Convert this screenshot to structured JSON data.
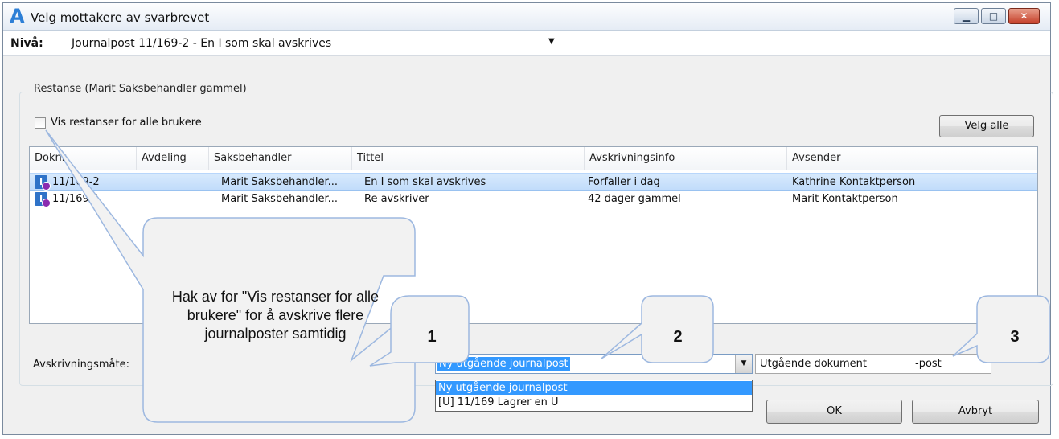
{
  "window": {
    "app_icon": "A",
    "title": "Velg mottakere av svarbrevet",
    "buttons": {
      "minimize": "▁",
      "maximize": "□",
      "close": "✕"
    }
  },
  "level": {
    "label": "Nivå:",
    "value": "Journalpost 11/169-2 - En I som skal avskrives",
    "arrow": "▼"
  },
  "restanse": {
    "group_title": "Restanse (Marit Saksbehandler gammel)",
    "checkbox_label": "Vis restanser for alle brukere",
    "checked": false,
    "select_all_label": "Velg alle"
  },
  "table": {
    "columns": [
      "Doknr",
      "Avdeling",
      "Saksbehandler",
      "Tittel",
      "Avskrivningsinfo",
      "Avsender"
    ],
    "rows": [
      {
        "icon": "I",
        "doknr": "11/169-2",
        "avdeling": "",
        "saksbehandler": "Marit Saksbehandler...",
        "tittel": "En I som skal avskrives",
        "avskrivningsinfo": "Forfaller i dag",
        "avsender": "Kathrine Kontaktperson",
        "selected": true
      },
      {
        "icon": "I",
        "doknr": "11/169-1",
        "avdeling": "",
        "saksbehandler": "Marit Saksbehandler...",
        "tittel": "Re avskriver",
        "avskrivningsinfo": "42 dager gammel",
        "avsender": "Marit Kontaktperson",
        "selected": false
      }
    ]
  },
  "avskrivning": {
    "label": "Avskrivningsmåte:",
    "combo_value": "Ny utgående journalpost",
    "combo_arrow": "▼",
    "options": [
      "Ny utgående journalpost",
      "[U] 11/169 Lagrer en U"
    ],
    "doc_type_1": "Utgående dokument",
    "doc_type_2": "-post"
  },
  "buttons": {
    "ok": "OK",
    "cancel": "Avbryt"
  },
  "annotations": {
    "tip": "Hak av for \"Vis restanser for alle brukere\" for å avskrive flere journalposter samtidig",
    "badge1": "1",
    "badge2": "2",
    "badge3": "3"
  },
  "colors": {
    "selection": "#3399ff",
    "row_selected": "#c9e1fb",
    "callout_fill": "#f2f2f2",
    "callout_stroke": "#9db8e0"
  }
}
